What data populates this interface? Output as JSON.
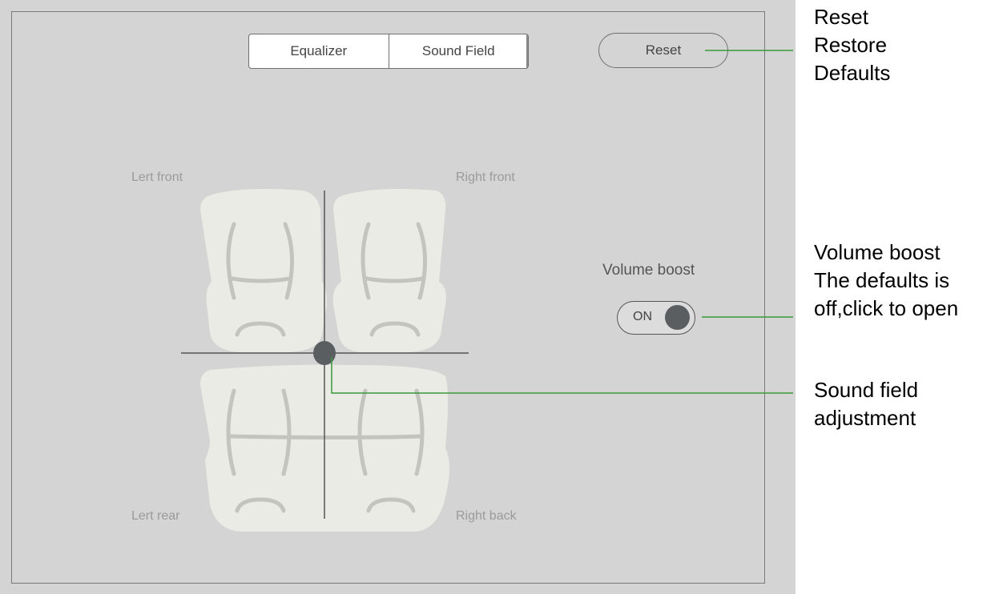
{
  "tabs": [
    {
      "label": "Equalizer",
      "active": false
    },
    {
      "label": "Sound Field",
      "active": true
    }
  ],
  "reset_label": "Reset",
  "sound_field": {
    "left_front": "Lert front",
    "right_front": "Right front",
    "left_rear": "Lert rear",
    "right_back": "Right back"
  },
  "volume_boost": {
    "label": "Volume boost",
    "toggle_text": "ON"
  },
  "annotations": {
    "reset": [
      "Reset",
      "Restore",
      "Defaults"
    ],
    "volume_boost": [
      "Volume boost",
      "The defaults is",
      "off,click to open"
    ],
    "sound_field": [
      "Sound field",
      "adjustment"
    ]
  },
  "colors": {
    "background": "#d4d4d4",
    "seat": "#ebebe6",
    "knob": "#5a5e60",
    "callout_line": "#3a9a3a"
  }
}
